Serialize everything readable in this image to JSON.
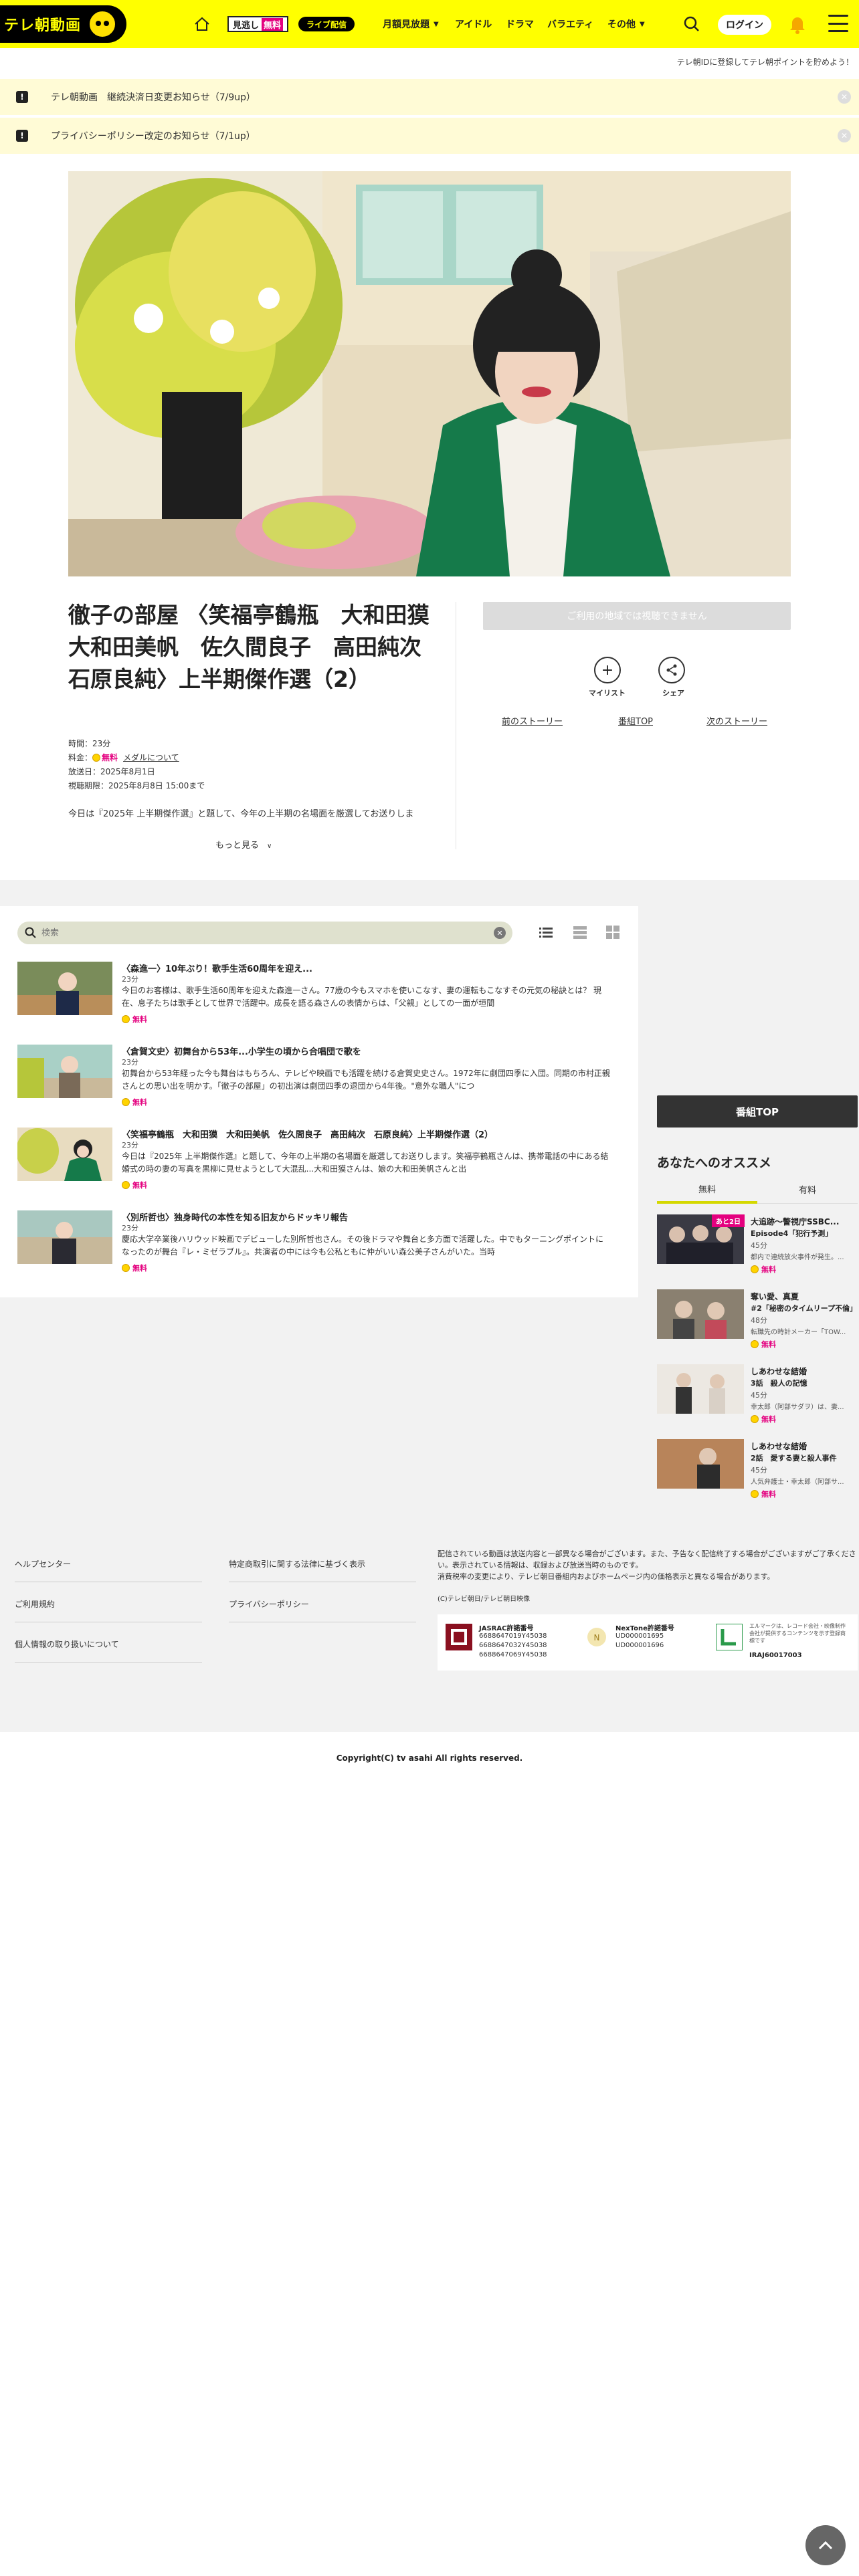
{
  "header": {
    "logo_text": "テレ朝動画",
    "mise_label": "見逃し",
    "mise_free": "無料",
    "live_label": "ライブ配信",
    "nav": [
      "月額見放題",
      "アイドル",
      "ドラマ",
      "バラエティ",
      "その他"
    ],
    "login_label": "ログイン",
    "promo_text": "テレ朝IDに登録してテレ朝ポイントを貯めよう！"
  },
  "notices": [
    {
      "text": "テレ朝動画　継続決済日変更お知らせ（7/9up）"
    },
    {
      "text": "プライバシーポリシー改定のお知らせ（7/1up）"
    }
  ],
  "program": {
    "title": "徹子の部屋 〈笑福亭鶴瓶　大和田獏　大和田美帆　佐久間良子　高田純次　石原良純〉上半期傑作選（2）",
    "duration": "時間：23分",
    "price_label": "料金：",
    "price_free": "無料",
    "medal_link": "メダルについて",
    "aired": "放送日：2025年8月1日",
    "expires": "視聴期限：2025年8月8日 15:00まで",
    "description": "今日は『2025年 上半期傑作選』と題して、今年の上半期の名場面を厳選してお送りしま",
    "more_label": "もっと見る",
    "unavailable": "ご利用の地域では視聴できません",
    "mylist_label": "マイリスト",
    "share_label": "シェア",
    "prev_story": "前のストーリー",
    "program_top": "番組TOP",
    "next_story": "次のストーリー"
  },
  "list": {
    "search_placeholder": "検索",
    "episodes": [
      {
        "title": "〈森進一〉10年ぶり！歌手生活60周年を迎え...",
        "duration": "23分",
        "desc": "今日のお客様は、歌手生活60周年を迎えた森進一さん。77歳の今もスマホを使いこなす、妻の運転もこなすその元気の秘訣とは？ 現在、息子たちは歌手として世界で活躍中。成長を語る森さんの表情からは、「父親」としての一面が垣間",
        "free": "無料"
      },
      {
        "title": "〈倉賀文史〉初舞台から53年...小学生の頃から合唱団で歌を",
        "duration": "23分",
        "desc": "初舞台から53年経った今も舞台はもちろん、テレビや映画でも活躍を続ける倉賀史史さん。1972年に劇団四季に入団。同期の市村正親さんとの思い出を明かす。「徹子の部屋」の初出演は劇団四季の退団から4年後。\"意外な職人\"につ",
        "free": "無料"
      },
      {
        "title": "〈笑福亭鶴瓶　大和田獏　大和田美帆　佐久間良子　高田純次　石原良純〉上半期傑作選（2）",
        "duration": "23分",
        "desc": "今日は『2025年 上半期傑作選』と題して、今年の上半期の名場面を厳選してお送りします。笑福亭鶴瓶さんは、携帯電話の中にある結婚式の時の妻の写真を黒柳に見せようとして大混乱...大和田獏さんは、娘の大和田美帆さんと出",
        "free": "無料"
      },
      {
        "title": "〈別所哲也〉独身時代の本性を知る旧友からドッキリ報告",
        "duration": "23分",
        "desc": "慶応大学卒業後ハリウッド映画でデビューした別所哲也さん。その後ドラマや舞台と多方面で活躍した。中でもターニングポイントになったのが舞台『レ・ミゼラブル』。共演者の中には今も公私ともに仲がいい森公美子さんがいた。当時",
        "free": "無料"
      }
    ]
  },
  "sidebar": {
    "program_top_button": "番組TOP",
    "heading": "あなたへのオススメ",
    "tab_free": "無料",
    "tab_paid": "有料",
    "items": [
      {
        "title": "大追跡～警視庁SSBC...",
        "subtitle": "Episode4「犯行予測」",
        "duration": "45分",
        "desc": "都内で連続放火事件が発生。...",
        "free": "無料",
        "badge": "あと2日"
      },
      {
        "title": "奪い愛、真夏",
        "subtitle": "#2「秘密のタイムリープ不倫」",
        "duration": "48分",
        "desc": "転職先の時計メーカー「TOW...",
        "free": "無料",
        "badge": ""
      },
      {
        "title": "しあわせな結婚",
        "subtitle": "3話　殺人の記憶",
        "duration": "45分",
        "desc": "幸太郎（阿部サダヲ）は、妻...",
        "free": "無料",
        "badge": ""
      },
      {
        "title": "しあわせな結婚",
        "subtitle": "2話　愛する妻と殺人事件",
        "duration": "45分",
        "desc": "人気弁護士・幸太郎（阿部サ...",
        "free": "無料",
        "badge": ""
      }
    ]
  },
  "footer": {
    "links_left": [
      "ヘルプセンター",
      "ご利用規約",
      "個人情報の取り扱いについて"
    ],
    "links_right": [
      "特定商取引に関する法律に基づく表示",
      "プライバシーポリシー"
    ],
    "note": "配信されている動画は放送内容と一部異なる場合がございます。また、予告なく配信終了する場合がございますがご了承ください。表示されている情報は、収録および放送当時のものです。\n消費税率の変更により、テレビ朝日番組内およびホームページ内の価格表示と異なる場合があります。",
    "copy_small": "(C)テレビ朝日/テレビ朝日映像",
    "jasrac_title": "JASRAC許諾番号",
    "jasrac_codes": [
      "6688647019Y45038",
      "6688647032Y45038",
      "6688647069Y45038"
    ],
    "nextone_title": "NexTone許諾番号",
    "nextone_codes": [
      "UD000001695",
      "UD000001696"
    ],
    "ermark_text": "エルマークは、レコード会社・映像制作会社が提供するコンテンツを示す登録商標です",
    "ermark_code": "IRAJ60017003",
    "copyright": "Copyright(C) tv asahi All rights reserved."
  }
}
